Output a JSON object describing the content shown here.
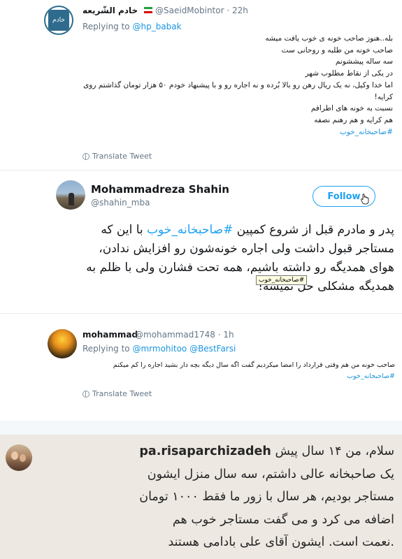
{
  "tweet1": {
    "display_name": "خادم الشّریعه",
    "handle": "@SaeidMobintor",
    "time": "22h",
    "replying_prefix": "Replying to",
    "replying_to": "@hp_babak",
    "lines": [
      "بله..هنوز صاحب خونه ی خوب یافت میشه",
      "صاحب خونه من طلبه و روحانی ست",
      "سه ساله پیششونم",
      "در یکی از نقاط مطلوب شهر",
      "اما خدا وکیل، نه یک ریال رهن رو بالا بُرده و نه اجاره رو و با پیشنهاد خودم ۵۰ هزار تومان گذاشتم روی",
      "کرایه!",
      "نسبت به خونه های اطرافم",
      "هم کرایه و هم رهنم نصفه"
    ],
    "hashtag": "#صاحبخانه_خوب",
    "translate": "Translate Tweet",
    "avatar_text": "خادم"
  },
  "tweet2": {
    "display_name": "Mohammadreza Shahin",
    "handle": "@shahin_mba",
    "follow_label": "Follow",
    "line1_before": "پدر و مادرم قبل از شروع کمپین ",
    "line1_hashtag": "#صاحبخانه_خوب",
    "line1_after": " با این که",
    "line2": "مستاجر قبول داشت ولی اجاره خونه‌شون رو افزایش ندادن،",
    "line3": "هوای همدیگه رو داشته باشیم، همه تحت فشارن ولی با ظلم به",
    "line4": "همدیگه مشکلی حل نمیشه!",
    "tooltip": "#صاحبخانه_خوب"
  },
  "tweet3": {
    "display_name": "mohammad",
    "handle": "@mohammad1748",
    "time": "1h",
    "replying_prefix": "Replying to",
    "replying_to": "@mrmohitoo @BestFarsi",
    "line1": "صاحب خونه من هم وقتی قرارداد را امضا میکردیم گفت اگه سال دیگه بچه دار بشید اجاره را کم میکنم",
    "hashtag": "#صاحبخانه_خوب",
    "translate": "Translate Tweet"
  },
  "instagram": {
    "username": "pa.risaparchizadeh",
    "line1_text": "سلام، من ۱۴ سال پیش",
    "line2": "یک صاحبخانه عالی داشتم، سه سال منزل ایشون",
    "line3": "مستاجر بودیم، هر سال با زور ما فقط ۱۰۰۰ تومان",
    "line4": "اضافه می کرد و می گفت مستاجر خوب هم",
    "line5": ".نعمت است. ایشون آقای علی بادامی هستند"
  },
  "colors": {
    "link": "#1b95e0",
    "follow": "#1da1f2",
    "instagram_bg": "#ede8e2"
  }
}
